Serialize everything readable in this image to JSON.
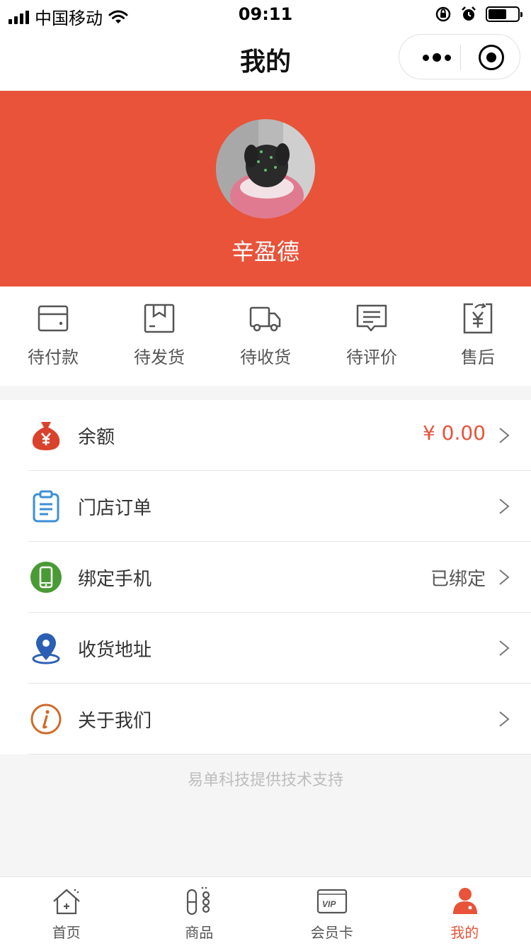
{
  "status_bar": {
    "carrier": "中国移动",
    "time": "09:11"
  },
  "nav": {
    "title": "我的"
  },
  "profile": {
    "name": "辛盈德"
  },
  "orders": [
    {
      "label": "待付款",
      "icon": "wallet-icon"
    },
    {
      "label": "待发货",
      "icon": "package-icon"
    },
    {
      "label": "待收货",
      "icon": "truck-icon"
    },
    {
      "label": "待评价",
      "icon": "comment-icon"
    },
    {
      "label": "售后",
      "icon": "refund-icon"
    }
  ],
  "menu": [
    {
      "label": "余额",
      "value": "¥ 0.00",
      "icon": "money-bag-icon",
      "color": "#d9432c"
    },
    {
      "label": "门店订单",
      "value": "",
      "icon": "clipboard-icon",
      "color": "#3d8fd6"
    },
    {
      "label": "绑定手机",
      "value": "已绑定",
      "icon": "phone-icon",
      "color": "#4a9a36"
    },
    {
      "label": "收货地址",
      "value": "",
      "icon": "location-pin-icon",
      "color": "#2b5fb4"
    },
    {
      "label": "关于我们",
      "value": "",
      "icon": "info-icon",
      "color": "#d06a2a"
    }
  ],
  "footer_note": "易单科技提供技术支持",
  "tabs": [
    {
      "label": "首页",
      "icon": "home-icon",
      "active": false
    },
    {
      "label": "商品",
      "icon": "goods-icon",
      "active": false
    },
    {
      "label": "会员卡",
      "icon": "vip-card-icon",
      "active": false
    },
    {
      "label": "我的",
      "icon": "user-icon",
      "active": true
    }
  ],
  "colors": {
    "brand": "#e8533a",
    "background": "#f5f5f5"
  }
}
